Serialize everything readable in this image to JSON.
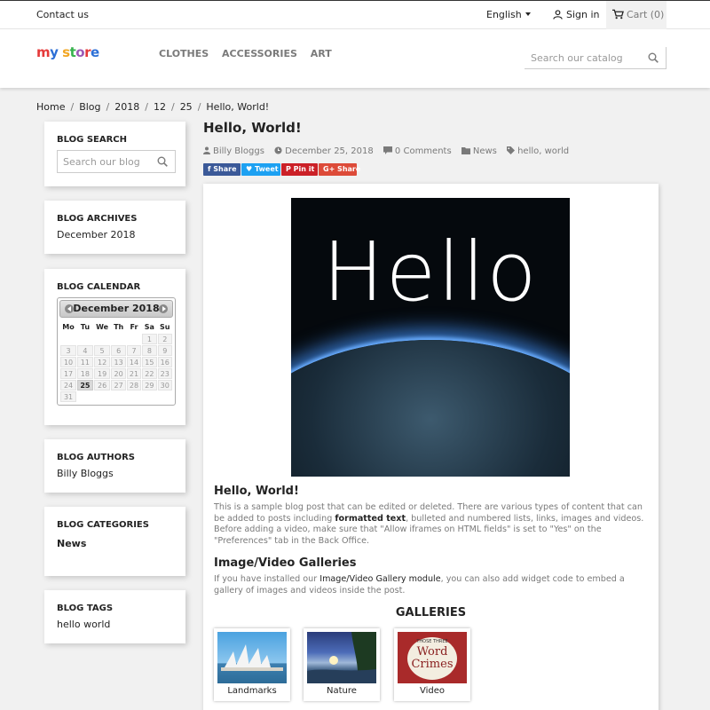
{
  "topnav": {
    "contact": "Contact us",
    "language": "English",
    "signin": "Sign in",
    "cart": "Cart (0)"
  },
  "header": {
    "logo": "my store",
    "menu": [
      "CLOTHES",
      "ACCESSORIES",
      "ART"
    ],
    "search_placeholder": "Search our catalog"
  },
  "breadcrumb": [
    "Home",
    "Blog",
    "2018",
    "12",
    "25",
    "Hello, World!"
  ],
  "sidebar": {
    "search": {
      "title": "BLOG SEARCH",
      "placeholder": "Search our blog"
    },
    "archives": {
      "title": "BLOG ARCHIVES",
      "item": "December 2018"
    },
    "calendar": {
      "title": "BLOG CALENDAR",
      "month": "December 2018",
      "weekdays": [
        "Mo",
        "Tu",
        "We",
        "Th",
        "Fr",
        "Sa",
        "Su"
      ],
      "weeks": [
        [
          "",
          "",
          "",
          "",
          "",
          "1",
          "2"
        ],
        [
          "3",
          "4",
          "5",
          "6",
          "7",
          "8",
          "9"
        ],
        [
          "10",
          "11",
          "12",
          "13",
          "14",
          "15",
          "16"
        ],
        [
          "17",
          "18",
          "19",
          "20",
          "21",
          "22",
          "23"
        ],
        [
          "24",
          "25",
          "26",
          "27",
          "28",
          "29",
          "30"
        ],
        [
          "31",
          "",
          "",
          "",
          "",
          "",
          ""
        ]
      ],
      "active_day": "25"
    },
    "authors": {
      "title": "BLOG AUTHORS",
      "item": "Billy Bloggs"
    },
    "categories": {
      "title": "BLOG CATEGORIES",
      "item": "News"
    },
    "tags": {
      "title": "BLOG TAGS",
      "item": "hello world"
    }
  },
  "post": {
    "title": "Hello, World!",
    "author": "Billy Bloggs",
    "date": "December 25, 2018",
    "comments": "0 Comments",
    "category": "News",
    "tags": "hello, world",
    "share": {
      "facebook": "f  Share",
      "twitter": "♥ Tweet",
      "pinterest": "P  Pin it",
      "google": "G+ Share"
    },
    "hero_text": "Hello",
    "content_heading": "Hello, World!",
    "content_p1_a": "This is a sample blog post that can be edited or deleted. There are various types of content that can be added to posts including ",
    "content_p1_bold": "formatted text",
    "content_p1_b": ", bulleted and numbered lists, links, images and videos. Before adding a video, make sure that \"Allow iframes on HTML fields\" is set to \"Yes\" on the \"Preferences\" tab in the Back Office.",
    "gallery_heading": "Image/Video Galleries",
    "gallery_p_a": "If you have installed our ",
    "gallery_p_link": "Image/Video Gallery module",
    "gallery_p_b": ", you can also add widget code to embed a gallery of images and videos inside the post.",
    "galleries_title": "GALLERIES",
    "galleries": [
      "Landmarks",
      "Nature",
      "Video"
    ],
    "video_thumb_text": [
      "THOSE THREE",
      "Word",
      "Crimes"
    ]
  }
}
